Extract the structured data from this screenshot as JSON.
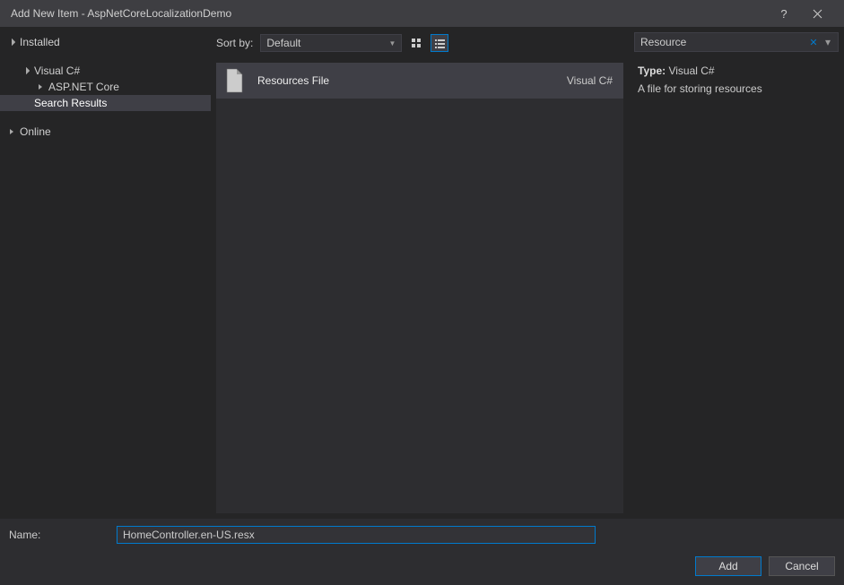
{
  "title": "Add New Item - AspNetCoreLocalizationDemo",
  "tree": {
    "installed": "Installed",
    "visual_csharp": "Visual C#",
    "aspnet_core": "ASP.NET Core",
    "search_results": "Search Results",
    "online": "Online"
  },
  "toolbar": {
    "sort_label": "Sort by:",
    "sort_value": "Default"
  },
  "template": {
    "name": "Resources File",
    "language": "Visual C#"
  },
  "search": {
    "value": "Resource"
  },
  "info": {
    "type_label": "Type:",
    "type_value": "Visual C#",
    "description": "A file for storing resources"
  },
  "name_field": {
    "label": "Name:",
    "value": "HomeController.en-US.resx"
  },
  "buttons": {
    "add": "Add",
    "cancel": "Cancel"
  }
}
